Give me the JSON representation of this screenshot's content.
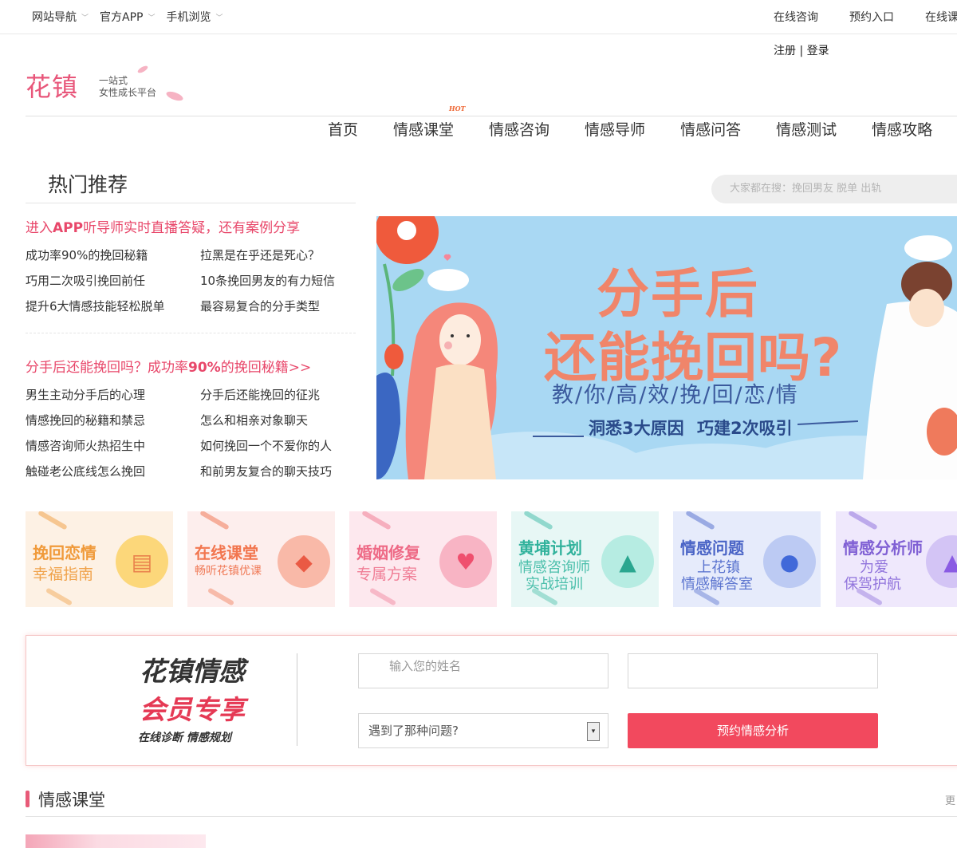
{
  "topbar": {
    "left": [
      {
        "label": "网站导航"
      },
      {
        "label": "官方APP"
      },
      {
        "label": "手机浏览"
      }
    ],
    "right": [
      {
        "label": "在线咨询"
      },
      {
        "label": "预约入口"
      },
      {
        "label": "在线课"
      }
    ]
  },
  "auth": {
    "register": "注册",
    "sep": "|",
    "login": "登录"
  },
  "logo": {
    "mark": "花镇",
    "slogan1": "一站式",
    "slogan2": "女性成长平台"
  },
  "nav": {
    "items": [
      "首页",
      "情感课堂",
      "情感咨询",
      "情感导师",
      "情感问答",
      "情感测试",
      "情感攻略"
    ],
    "hot_badge": "HOT"
  },
  "hot": {
    "title": "热门推荐",
    "search_placeholder": "大家都在搜：挽回男友 脱单 出轨",
    "promo1": {
      "pre": "进入",
      "strong": "APP",
      "post": "听导师实时直播答疑，还有案例分享"
    },
    "group1": [
      "成功率90%的挽回秘籍",
      "拉黑是在乎还是死心？",
      "巧用二次吸引挽回前任",
      "10条挽回男友的有力短信",
      "提升6大情感技能轻松脱单",
      "最容易复合的分手类型"
    ],
    "promo2": {
      "pre": "分手后还能挽回吗？成功率",
      "strong": "90%",
      "post": "的挽回秘籍>>"
    },
    "group2": [
      "男生主动分手后的心理",
      "分手后还能挽回的征兆",
      "情感挽回的秘籍和禁忌",
      "怎么和相亲对象聊天",
      "情感咨询师火热招生中",
      "如何挽回一个不爱你的人",
      "触碰老公底线怎么挽回",
      "和前男友复合的聊天技巧"
    ]
  },
  "banner": {
    "line1": "分手后",
    "line2": "还能挽回吗?",
    "line3": "教/你/高/效/挽/回/恋/情",
    "line4a": "洞悉3大原因",
    "line4b": "巧建2次吸引"
  },
  "tiles": [
    {
      "a": "挽回恋情",
      "b": "幸福指南",
      "bg": "#fdf1e4",
      "ca": "#f09a3a",
      "cb": "#f0a24a",
      "icon": "book-icon",
      "glyph": "▤",
      "icbg": "#fcd77a",
      "icfg": "#e9814c"
    },
    {
      "a": "在线课堂",
      "b": "畅听花镇优课",
      "bg": "#fdeeed",
      "ca": "#f2764f",
      "cb": "#f07a57",
      "icon": "diamond-icon",
      "glyph": "◆",
      "icbg": "#f9b9a8",
      "icfg": "#ea5a44"
    },
    {
      "a": "婚姻修复",
      "b": "专属方案",
      "bg": "#fde8ee",
      "ca": "#ee6a86",
      "cb": "#f07e96",
      "icon": "heart-icon",
      "glyph": "♥",
      "icbg": "#f8b4c4",
      "icfg": "#ef4f6e"
    },
    {
      "a": "黄埔计划",
      "b": "情感咨询师",
      "c": "实战培训",
      "bg": "#e7f7f5",
      "ca": "#31b29c",
      "cb": "#4bbfab",
      "icon": "snow-globe-icon",
      "glyph": "▲",
      "icbg": "#b6ece2",
      "icfg": "#2aa68f"
    },
    {
      "a": "情感问题",
      "b": "上花镇",
      "c": "情感解答室",
      "bg": "#e6ebfb",
      "ca": "#4a64c6",
      "cb": "#5b74cf",
      "icon": "lightbulb-icon",
      "glyph": "●",
      "icbg": "#bccaf3",
      "icfg": "#4169d9"
    },
    {
      "a": "情感分析师",
      "b": "为爱",
      "c": "保驾护航",
      "bg": "#efe8fc",
      "ca": "#8060d4",
      "cb": "#9174dc",
      "icon": "pyramid-icon",
      "glyph": "▲",
      "icbg": "#d3c4f5",
      "icfg": "#8a5be3"
    }
  ],
  "member": {
    "title1": "花镇情感",
    "title2": "会员专享",
    "sub": "在线诊断   情感规划",
    "name_placeholder": "输入您的姓名",
    "phone_placeholder": "",
    "problem_select": "遇到了那种问题?",
    "submit": "预约情感分析"
  },
  "section": {
    "title": "情感课堂",
    "more": "更"
  }
}
